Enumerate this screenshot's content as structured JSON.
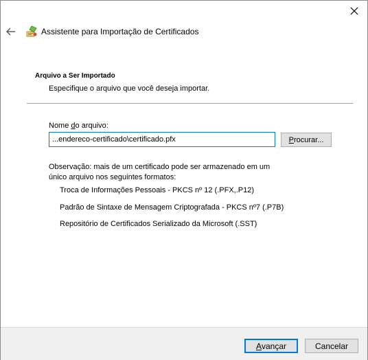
{
  "window": {
    "title": "Assistente para Importação de Certificados"
  },
  "icons": {
    "close": "close-icon",
    "back": "back-arrow-icon",
    "wizard": "certificate-wizard-icon"
  },
  "header": {
    "section_title": "Arquivo a Ser Importado",
    "section_subtitle": "Especifique o arquivo que você deseja importar."
  },
  "form": {
    "file_label_prefix": "Nome ",
    "file_label_accel": "d",
    "file_label_suffix": "o arquivo:",
    "file_value": "...endereco-certificado\\certificado.pfx",
    "browse_accel": "P",
    "browse_rest": "rocurar..."
  },
  "note": {
    "text": "Observação: mais de um certificado pode ser armazenado em um único arquivo nos seguintes formatos:",
    "formats": [
      "Troca de Informações Pessoais - PKCS nº 12 (.PFX,.P12)",
      "Padrão de Sintaxe de Mensagem Criptografada - PKCS nº7 (.P7B)",
      "Repositório de Certificados Serializado da Microsoft (.SST)"
    ]
  },
  "footer": {
    "next_accel": "A",
    "next_rest": "vançar",
    "cancel_label": "Cancelar"
  },
  "colors": {
    "accent": "#0078d7",
    "footer_bg": "#f0f0f0",
    "button_bg": "#e1e1e1"
  }
}
